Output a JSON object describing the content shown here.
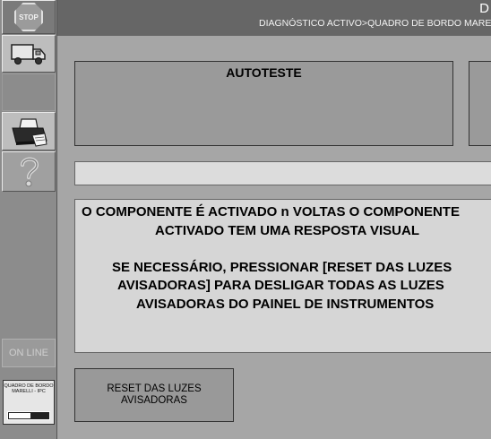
{
  "header": {
    "title_fragment": "D",
    "breadcrumb": "DIAGNÓSTICO ACTIVO>QUADRO DE BORDO MARELLI"
  },
  "sidebar": {
    "stop_label": "STOP",
    "online_label": "ON LINE",
    "device": {
      "label": "QUADRO DE BORDO MARELLI - IPC",
      "progress": 0.55
    }
  },
  "main": {
    "autoteste_title": "AUTOTESTE",
    "message_lines": [
      "O COMPONENTE É ACTIVADO n VOLTAS   O COMPONENTE",
      "ACTIVADO TEM UMA RESPOSTA VISUAL",
      "",
      "SE NECESSÁRIO, PRESSIONAR [RESET DAS LUZES",
      "AVISADORAS] PARA DESLIGAR TODAS AS LUZES",
      "AVISADORAS DO PAINEL DE INSTRUMENTOS"
    ],
    "reset_button_line1": "RESET DAS LUZES",
    "reset_button_line2": "AVISADORAS"
  }
}
